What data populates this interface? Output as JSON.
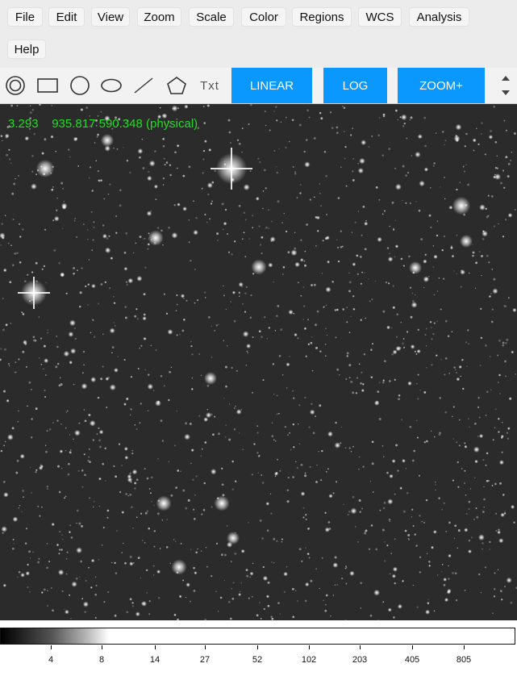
{
  "menu": {
    "items": [
      {
        "label": "File"
      },
      {
        "label": "Edit"
      },
      {
        "label": "View"
      },
      {
        "label": "Zoom"
      },
      {
        "label": "Scale"
      },
      {
        "label": "Color"
      },
      {
        "label": "Regions"
      },
      {
        "label": "WCS"
      },
      {
        "label": "Analysis"
      },
      {
        "label": "Help"
      }
    ]
  },
  "toolbar": {
    "text_tool": "Txt",
    "linear_label": "LINEAR",
    "log_label": "LOG",
    "zoom_label": "ZOOM+"
  },
  "viewer": {
    "coord_readout": "3.293    935.817 590.348 (physical)"
  },
  "colorbar": {
    "ticks": [
      "4",
      "8",
      "14",
      "27",
      "52",
      "102",
      "203",
      "405",
      "805"
    ]
  }
}
